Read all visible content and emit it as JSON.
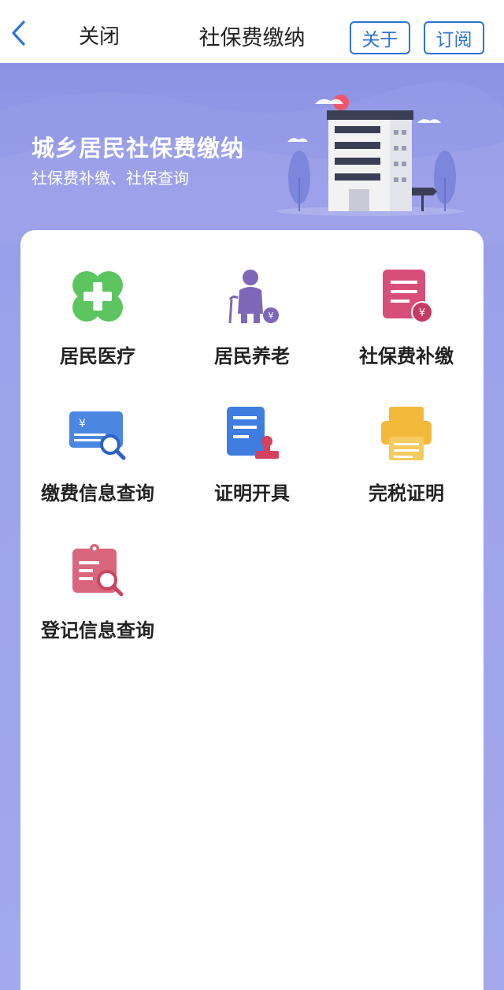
{
  "navbar": {
    "close_label": "关闭",
    "title": "社保费缴纳",
    "about_label": "关于",
    "subscribe_label": "订阅"
  },
  "banner": {
    "title": "城乡居民社保费缴纳",
    "subtitle": "社保费补缴、社保查询"
  },
  "services": [
    {
      "label": "居民医疗",
      "icon": "medical-cross-icon"
    },
    {
      "label": "居民养老",
      "icon": "elderly-person-icon"
    },
    {
      "label": "社保费补缴",
      "icon": "document-yuan-icon"
    },
    {
      "label": "缴费信息查询",
      "icon": "card-search-icon"
    },
    {
      "label": "证明开具",
      "icon": "document-stamp-icon"
    },
    {
      "label": "完税证明",
      "icon": "printer-icon"
    },
    {
      "label": "登记信息查询",
      "icon": "clipboard-search-icon"
    }
  ],
  "colors": {
    "accent": "#2d73d6",
    "background": "#9da3ea"
  }
}
